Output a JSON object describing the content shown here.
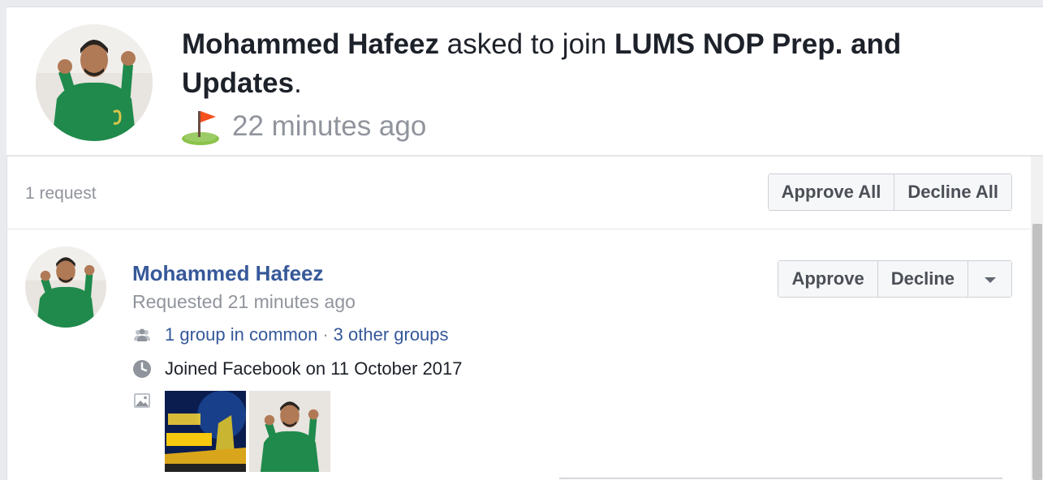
{
  "notification": {
    "actor": "Mohammed Hafeez",
    "action": " asked to join ",
    "group": "LUMS NOP Prep. and Updates",
    "period": ".",
    "time": "22 minutes ago",
    "icon": "golf-flag-icon"
  },
  "requests": {
    "count_label": "1 request",
    "approve_all": "Approve All",
    "decline_all": "Decline All"
  },
  "request": {
    "name": "Mohammed Hafeez",
    "requested_time": "Requested 21 minutes ago",
    "groups_in_common": "1 group in common",
    "separator": "·",
    "other_groups": "3 other groups",
    "joined": "Joined Facebook on 11 October 2017",
    "approve": "Approve",
    "decline": "Decline",
    "more_icon": "caret-down-icon"
  },
  "colors": {
    "link": "#365899",
    "meta": "#90949c",
    "text": "#1d2129",
    "jersey_green": "#1f8a4c"
  }
}
